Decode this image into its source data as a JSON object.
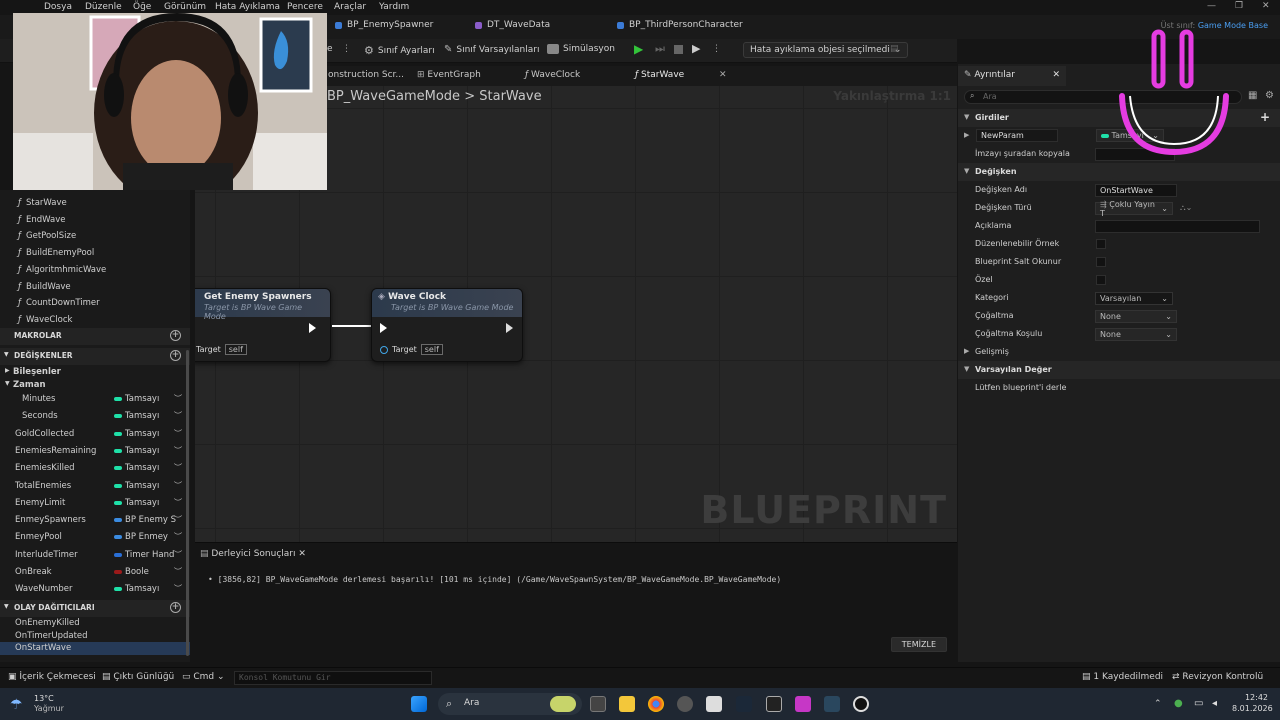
{
  "menu": [
    "Dosya",
    "Düzenle",
    "Öğe",
    "Görünüm",
    "Hata Ayıklama",
    "Pencere",
    "Araçlar",
    "Yardım"
  ],
  "asset_tabs": [
    "BP_EnemySpawner",
    "DT_WaveData",
    "BP_ThirdPersonCharacter"
  ],
  "parent_class": {
    "label": "Üst sınıf:",
    "value": "Game Mode Base"
  },
  "toolbar": {
    "class_settings": "Sınıf Ayarları",
    "class_defaults": "Sınıf Varsayılanları",
    "simulation": "Simülasyon",
    "debug_object": "Hata ayıklama objesi seçilmedi",
    "e_label": "e"
  },
  "graph_tabs": [
    "onstruction Scr...",
    "EventGraph",
    "WaveClock",
    "StarWave"
  ],
  "breadcrumb": {
    "parent": "BP_WaveGameMode",
    "current": "StarWave",
    "sep": ">"
  },
  "zoom": "Yakınlaştırma 1:1",
  "watermark": "BLUEPRINT",
  "nodes": [
    {
      "title": "Get Enemy Spawners",
      "subtitle": "Target is BP Wave Game Mode",
      "pin": "Target",
      "pin_value": "self"
    },
    {
      "title": "Wave Clock",
      "subtitle": "Target is BP Wave Game Mode",
      "pin": "Target",
      "pin_value": "self"
    }
  ],
  "compiler": {
    "tab": "Derleyici Sonuçları",
    "log": "• [3856,82] BP_WaveGameMode derlemesi başarılı! [101 ms içinde] (/Game/WaveSpawnSystem/BP_WaveGameMode.BP_WaveGameMode)",
    "clear": "TEMİZLE"
  },
  "functions": [
    "StarWave",
    "EndWave",
    "GetPoolSize",
    "BuildEnemyPool",
    "AlgoritmhmicWave",
    "BuildWave",
    "CountDownTimer",
    "WaveClock"
  ],
  "sections": {
    "macros": "MAKROLAR",
    "variables": "DEĞİŞKENLER",
    "dispatchers": "OLAY DAĞITICILARI"
  },
  "var_groups": {
    "components": "Bileşenler",
    "time": "Zaman"
  },
  "variables": [
    {
      "name": "Minutes",
      "type": "Tamsayı",
      "color": "#1fe0a8",
      "indent": true
    },
    {
      "name": "Seconds",
      "type": "Tamsayı",
      "color": "#1fe0a8",
      "indent": true
    },
    {
      "name": "GoldCollected",
      "type": "Tamsayı",
      "color": "#1fe0a8"
    },
    {
      "name": "EnemiesRemaining",
      "type": "Tamsayı",
      "color": "#1fe0a8"
    },
    {
      "name": "EnemiesKilled",
      "type": "Tamsayı",
      "color": "#1fe0a8"
    },
    {
      "name": "TotalEnemies",
      "type": "Tamsayı",
      "color": "#1fe0a8"
    },
    {
      "name": "EnemyLimit",
      "type": "Tamsayı",
      "color": "#1fe0a8"
    },
    {
      "name": "EnmeySpawners",
      "type": "BP Enemy S",
      "color": "#3b8be0"
    },
    {
      "name": "EnmeyPool",
      "type": "BP Enmey",
      "color": "#3b8be0"
    },
    {
      "name": "InterludeTimer",
      "type": "Timer Hand",
      "color": "#2a6fd6"
    },
    {
      "name": "OnBreak",
      "type": "Boole",
      "color": "#9b1a1a"
    },
    {
      "name": "WaveNumber",
      "type": "Tamsayı",
      "color": "#1fe0a8"
    }
  ],
  "dispatchers": [
    "OnEnemyKilled",
    "OnTimerUpdated",
    "OnStartWave"
  ],
  "details": {
    "tab": "Ayrıntılar",
    "search_placeholder": "Ara",
    "inputs_header": "Girdiler",
    "param_name": "NewParam",
    "param_type": "Tamsayı",
    "copy_signature": "İmzayı şuradan kopyala",
    "variable_header": "Değişken",
    "var_name_label": "Değişken Adı",
    "var_name": "OnStartWave",
    "var_type_label": "Değişken Türü",
    "var_type": "Çoklu Yayın T",
    "description_label": "Açıklama",
    "editable_label": "Düzenlenebilir Örnek",
    "readonly_label": "Blueprint Salt Okunur",
    "private_label": "Özel",
    "category_label": "Kategori",
    "category": "Varsayılan",
    "replication_label": "Çoğaltma",
    "replication": "None",
    "repl_cond_label": "Çoğaltma Koşulu",
    "repl_cond": "None",
    "advanced": "Gelişmiş",
    "default_header": "Varsayılan Değer",
    "default_note": "Lütfen blueprint'i derle"
  },
  "status": {
    "content_drawer": "İçerik Çekmecesi",
    "output_log": "Çıktı Günlüğü",
    "cmd": "Cmd",
    "console_placeholder": "Konsol Komutunu Gir",
    "saved": "1 Kaydedilmedi",
    "revision": "Revizyon Kontrolü"
  },
  "taskbar": {
    "temp": "13°C",
    "weather": "Yağmur",
    "search": "Ara",
    "time": "12:42",
    "date": "8.01.2026"
  }
}
